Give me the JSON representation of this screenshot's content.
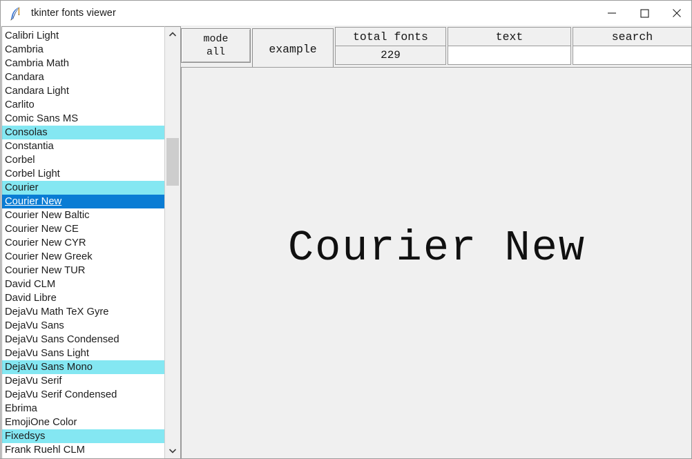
{
  "window": {
    "title": "tkinter fonts viewer",
    "icon": "feather-quill-icon",
    "controls": {
      "minimize": "minimize-icon",
      "maximize": "maximize-icon",
      "close": "close-icon"
    }
  },
  "colors": {
    "mono_highlight": "#84e7f2",
    "selection": "#0a7cd4",
    "panel": "#f0f0f0",
    "list_background": "#ffffff",
    "border": "#9b9b9b"
  },
  "toolbar": {
    "mode_button": {
      "title": "mode",
      "value": "all"
    },
    "example_tab": "example",
    "total_fonts": {
      "label": "total fonts",
      "value": "229"
    },
    "text_field": {
      "label": "text",
      "value": "",
      "placeholder": ""
    },
    "search_field": {
      "label": "search",
      "value": "",
      "placeholder": ""
    }
  },
  "preview": {
    "sample_text": "Courier New"
  },
  "scrollbar": {
    "up_arrow": "chevron-up-icon",
    "down_arrow": "chevron-down-icon"
  },
  "font_list": {
    "selected": "Courier New",
    "items": [
      {
        "name": "Calibri Light",
        "mono": false,
        "selected": false
      },
      {
        "name": "Cambria",
        "mono": false,
        "selected": false
      },
      {
        "name": "Cambria Math",
        "mono": false,
        "selected": false
      },
      {
        "name": "Candara",
        "mono": false,
        "selected": false
      },
      {
        "name": "Candara Light",
        "mono": false,
        "selected": false
      },
      {
        "name": "Carlito",
        "mono": false,
        "selected": false
      },
      {
        "name": "Comic Sans MS",
        "mono": false,
        "selected": false
      },
      {
        "name": "Consolas",
        "mono": true,
        "selected": false
      },
      {
        "name": "Constantia",
        "mono": false,
        "selected": false
      },
      {
        "name": "Corbel",
        "mono": false,
        "selected": false
      },
      {
        "name": "Corbel Light",
        "mono": false,
        "selected": false
      },
      {
        "name": "Courier",
        "mono": true,
        "selected": false
      },
      {
        "name": "Courier New",
        "mono": true,
        "selected": true
      },
      {
        "name": "Courier New Baltic",
        "mono": false,
        "selected": false
      },
      {
        "name": "Courier New CE",
        "mono": false,
        "selected": false
      },
      {
        "name": "Courier New CYR",
        "mono": false,
        "selected": false
      },
      {
        "name": "Courier New Greek",
        "mono": false,
        "selected": false
      },
      {
        "name": "Courier New TUR",
        "mono": false,
        "selected": false
      },
      {
        "name": "David CLM",
        "mono": false,
        "selected": false
      },
      {
        "name": "David Libre",
        "mono": false,
        "selected": false
      },
      {
        "name": "DejaVu Math TeX Gyre",
        "mono": false,
        "selected": false
      },
      {
        "name": "DejaVu Sans",
        "mono": false,
        "selected": false
      },
      {
        "name": "DejaVu Sans Condensed",
        "mono": false,
        "selected": false
      },
      {
        "name": "DejaVu Sans Light",
        "mono": false,
        "selected": false
      },
      {
        "name": "DejaVu Sans Mono",
        "mono": true,
        "selected": false
      },
      {
        "name": "DejaVu Serif",
        "mono": false,
        "selected": false
      },
      {
        "name": "DejaVu Serif Condensed",
        "mono": false,
        "selected": false
      },
      {
        "name": "Ebrima",
        "mono": false,
        "selected": false
      },
      {
        "name": "EmojiOne Color",
        "mono": false,
        "selected": false
      },
      {
        "name": "Fixedsys",
        "mono": true,
        "selected": false
      },
      {
        "name": "Frank Ruehl CLM",
        "mono": false,
        "selected": false
      }
    ]
  }
}
